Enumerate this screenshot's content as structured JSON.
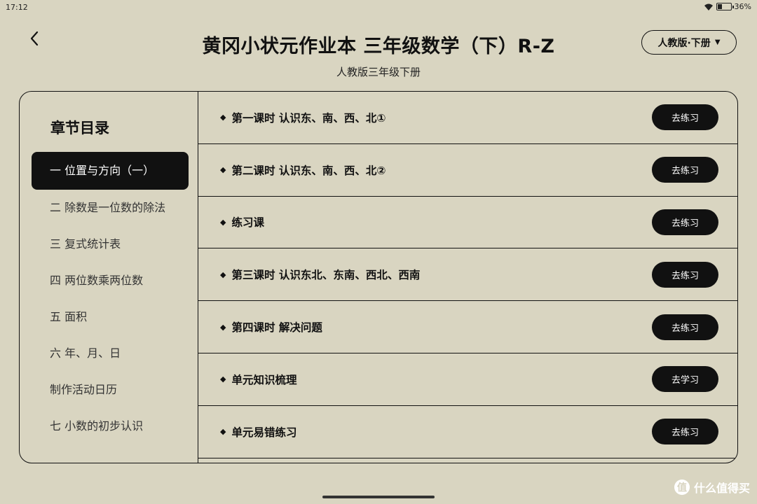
{
  "status": {
    "time": "17:12",
    "battery": "36%"
  },
  "header": {
    "title": "黄冈小状元作业本 三年级数学（下）R-Z",
    "subtitle": "人教版三年级下册",
    "edition_label": "人教版·下册"
  },
  "sidebar": {
    "title": "章节目录",
    "items": [
      {
        "label": "一 位置与方向（一）",
        "active": true
      },
      {
        "label": "二 除数是一位数的除法"
      },
      {
        "label": "三 复式统计表"
      },
      {
        "label": "四 两位数乘两位数"
      },
      {
        "label": "五 面积"
      },
      {
        "label": "六 年、月、日"
      },
      {
        "label": "制作活动日历"
      },
      {
        "label": "七 小数的初步认识"
      }
    ]
  },
  "lessons": [
    {
      "title": "第一课时 认识东、南、西、北①",
      "button": "去练习"
    },
    {
      "title": "第二课时 认识东、南、西、北②",
      "button": "去练习"
    },
    {
      "title": "练习课",
      "button": "去练习"
    },
    {
      "title": "第三课时 认识东北、东南、西北、西南",
      "button": "去练习"
    },
    {
      "title": "第四课时 解决问题",
      "button": "去练习"
    },
    {
      "title": "单元知识梳理",
      "button": "去学习"
    },
    {
      "title": "单元易错练习",
      "button": "去练习"
    }
  ],
  "watermark": {
    "logo": "值",
    "text": "什么值得买"
  }
}
